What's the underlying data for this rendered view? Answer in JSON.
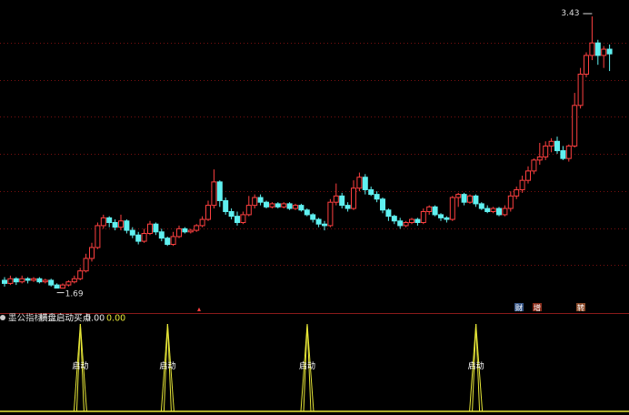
{
  "indicator_bar": {
    "name": "墨公指标",
    "signal_label": "横盘启动买点",
    "value1": "0.00",
    "value2": "0.00"
  },
  "price_annotations": {
    "high_label": "3.43",
    "low_label": "1.69"
  },
  "markers": [
    {
      "text": "财",
      "color": "#3b5a8a"
    },
    {
      "text": "增",
      "color": "#8a2f1e"
    },
    {
      "text": "转",
      "color": "#8a4a2a"
    }
  ],
  "colors": {
    "up": "#ff4040",
    "down": "#5ff0f0",
    "grid": "#7a1010",
    "signal": "#e8e838",
    "separator": "#8a1a1a"
  },
  "chart_data": [
    {
      "type": "candlestick",
      "price_range": [
        1.6,
        3.5
      ],
      "candles": [
        {
          "o": 1.74,
          "c": 1.72,
          "h": 1.76,
          "l": 1.7
        },
        {
          "o": 1.72,
          "c": 1.75,
          "h": 1.77,
          "l": 1.71
        },
        {
          "o": 1.75,
          "c": 1.73,
          "h": 1.76,
          "l": 1.71
        },
        {
          "o": 1.73,
          "c": 1.75,
          "h": 1.77,
          "l": 1.72
        },
        {
          "o": 1.75,
          "c": 1.74,
          "h": 1.76,
          "l": 1.72
        },
        {
          "o": 1.74,
          "c": 1.75,
          "h": 1.76,
          "l": 1.73
        },
        {
          "o": 1.75,
          "c": 1.73,
          "h": 1.76,
          "l": 1.72
        },
        {
          "o": 1.73,
          "c": 1.74,
          "h": 1.75,
          "l": 1.72
        },
        {
          "o": 1.74,
          "c": 1.71,
          "h": 1.75,
          "l": 1.7
        },
        {
          "o": 1.71,
          "c": 1.69,
          "h": 1.72,
          "l": 1.69
        },
        {
          "o": 1.69,
          "c": 1.71,
          "h": 1.72,
          "l": 1.69
        },
        {
          "o": 1.71,
          "c": 1.73,
          "h": 1.74,
          "l": 1.7
        },
        {
          "o": 1.73,
          "c": 1.75,
          "h": 1.77,
          "l": 1.72
        },
        {
          "o": 1.75,
          "c": 1.8,
          "h": 1.82,
          "l": 1.74
        },
        {
          "o": 1.8,
          "c": 1.88,
          "h": 1.91,
          "l": 1.79
        },
        {
          "o": 1.88,
          "c": 1.95,
          "h": 1.98,
          "l": 1.86
        },
        {
          "o": 1.95,
          "c": 2.09,
          "h": 2.11,
          "l": 1.94
        },
        {
          "o": 2.09,
          "c": 2.14,
          "h": 2.16,
          "l": 2.07
        },
        {
          "o": 2.14,
          "c": 2.11,
          "h": 2.15,
          "l": 2.08
        },
        {
          "o": 2.11,
          "c": 2.08,
          "h": 2.13,
          "l": 2.06
        },
        {
          "o": 2.08,
          "c": 2.12,
          "h": 2.16,
          "l": 2.06
        },
        {
          "o": 2.12,
          "c": 2.06,
          "h": 2.13,
          "l": 2.04
        },
        {
          "o": 2.06,
          "c": 2.03,
          "h": 2.08,
          "l": 2.01
        },
        {
          "o": 2.03,
          "c": 1.99,
          "h": 2.05,
          "l": 1.97
        },
        {
          "o": 1.99,
          "c": 2.04,
          "h": 2.07,
          "l": 1.98
        },
        {
          "o": 2.04,
          "c": 2.1,
          "h": 2.12,
          "l": 2.03
        },
        {
          "o": 2.1,
          "c": 2.05,
          "h": 2.11,
          "l": 2.03
        },
        {
          "o": 2.05,
          "c": 2.01,
          "h": 2.07,
          "l": 1.99
        },
        {
          "o": 2.01,
          "c": 1.97,
          "h": 2.02,
          "l": 1.96
        },
        {
          "o": 1.97,
          "c": 2.02,
          "h": 2.05,
          "l": 1.96
        },
        {
          "o": 2.02,
          "c": 2.07,
          "h": 2.09,
          "l": 2.01
        },
        {
          "o": 2.07,
          "c": 2.05,
          "h": 2.08,
          "l": 2.04
        },
        {
          "o": 2.05,
          "c": 2.06,
          "h": 2.07,
          "l": 2.04
        },
        {
          "o": 2.06,
          "c": 2.09,
          "h": 2.1,
          "l": 2.05
        },
        {
          "o": 2.09,
          "c": 2.13,
          "h": 2.15,
          "l": 2.08
        },
        {
          "o": 2.13,
          "c": 2.22,
          "h": 2.25,
          "l": 2.12
        },
        {
          "o": 2.22,
          "c": 2.37,
          "h": 2.45,
          "l": 2.2
        },
        {
          "o": 2.37,
          "c": 2.25,
          "h": 2.38,
          "l": 2.21
        },
        {
          "o": 2.25,
          "c": 2.18,
          "h": 2.27,
          "l": 2.16
        },
        {
          "o": 2.18,
          "c": 2.15,
          "h": 2.2,
          "l": 2.13
        },
        {
          "o": 2.15,
          "c": 2.11,
          "h": 2.18,
          "l": 2.09
        },
        {
          "o": 2.11,
          "c": 2.16,
          "h": 2.18,
          "l": 2.1
        },
        {
          "o": 2.16,
          "c": 2.22,
          "h": 2.28,
          "l": 2.15
        },
        {
          "o": 2.22,
          "c": 2.27,
          "h": 2.29,
          "l": 2.2
        },
        {
          "o": 2.27,
          "c": 2.24,
          "h": 2.29,
          "l": 2.22
        },
        {
          "o": 2.24,
          "c": 2.21,
          "h": 2.25,
          "l": 2.2
        },
        {
          "o": 2.21,
          "c": 2.23,
          "h": 2.24,
          "l": 2.2
        },
        {
          "o": 2.23,
          "c": 2.21,
          "h": 2.24,
          "l": 2.2
        },
        {
          "o": 2.21,
          "c": 2.23,
          "h": 2.24,
          "l": 2.2
        },
        {
          "o": 2.23,
          "c": 2.2,
          "h": 2.24,
          "l": 2.19
        },
        {
          "o": 2.2,
          "c": 2.22,
          "h": 2.23,
          "l": 2.19
        },
        {
          "o": 2.22,
          "c": 2.19,
          "h": 2.23,
          "l": 2.18
        },
        {
          "o": 2.19,
          "c": 2.16,
          "h": 2.2,
          "l": 2.15
        },
        {
          "o": 2.16,
          "c": 2.13,
          "h": 2.17,
          "l": 2.11
        },
        {
          "o": 2.13,
          "c": 2.1,
          "h": 2.14,
          "l": 2.08
        },
        {
          "o": 2.1,
          "c": 2.09,
          "h": 2.12,
          "l": 2.06
        },
        {
          "o": 2.09,
          "c": 2.24,
          "h": 2.26,
          "l": 2.08
        },
        {
          "o": 2.24,
          "c": 2.28,
          "h": 2.36,
          "l": 2.22
        },
        {
          "o": 2.28,
          "c": 2.22,
          "h": 2.3,
          "l": 2.2
        },
        {
          "o": 2.22,
          "c": 2.2,
          "h": 2.24,
          "l": 2.18
        },
        {
          "o": 2.2,
          "c": 2.33,
          "h": 2.38,
          "l": 2.19
        },
        {
          "o": 2.33,
          "c": 2.4,
          "h": 2.43,
          "l": 2.31
        },
        {
          "o": 2.4,
          "c": 2.32,
          "h": 2.42,
          "l": 2.29
        },
        {
          "o": 2.32,
          "c": 2.29,
          "h": 2.34,
          "l": 2.28
        },
        {
          "o": 2.29,
          "c": 2.26,
          "h": 2.31,
          "l": 2.24
        },
        {
          "o": 2.26,
          "c": 2.19,
          "h": 2.27,
          "l": 2.17
        },
        {
          "o": 2.19,
          "c": 2.15,
          "h": 2.2,
          "l": 2.12
        },
        {
          "o": 2.15,
          "c": 2.12,
          "h": 2.16,
          "l": 2.1
        },
        {
          "o": 2.12,
          "c": 2.09,
          "h": 2.14,
          "l": 2.07
        },
        {
          "o": 2.09,
          "c": 2.11,
          "h": 2.12,
          "l": 2.08
        },
        {
          "o": 2.11,
          "c": 2.13,
          "h": 2.14,
          "l": 2.1
        },
        {
          "o": 2.13,
          "c": 2.11,
          "h": 2.14,
          "l": 2.09
        },
        {
          "o": 2.11,
          "c": 2.18,
          "h": 2.2,
          "l": 2.1
        },
        {
          "o": 2.18,
          "c": 2.21,
          "h": 2.22,
          "l": 2.16
        },
        {
          "o": 2.21,
          "c": 2.16,
          "h": 2.22,
          "l": 2.15
        },
        {
          "o": 2.16,
          "c": 2.14,
          "h": 2.17,
          "l": 2.12
        },
        {
          "o": 2.14,
          "c": 2.13,
          "h": 2.15,
          "l": 2.11
        },
        {
          "o": 2.13,
          "c": 2.27,
          "h": 2.28,
          "l": 2.12
        },
        {
          "o": 2.27,
          "c": 2.29,
          "h": 2.3,
          "l": 2.21
        },
        {
          "o": 2.29,
          "c": 2.24,
          "h": 2.3,
          "l": 2.22
        },
        {
          "o": 2.24,
          "c": 2.28,
          "h": 2.29,
          "l": 2.23
        },
        {
          "o": 2.28,
          "c": 2.23,
          "h": 2.29,
          "l": 2.21
        },
        {
          "o": 2.23,
          "c": 2.2,
          "h": 2.24,
          "l": 2.19
        },
        {
          "o": 2.2,
          "c": 2.18,
          "h": 2.22,
          "l": 2.17
        },
        {
          "o": 2.18,
          "c": 2.2,
          "h": 2.21,
          "l": 2.17
        },
        {
          "o": 2.2,
          "c": 2.16,
          "h": 2.21,
          "l": 2.15
        },
        {
          "o": 2.16,
          "c": 2.2,
          "h": 2.22,
          "l": 2.15
        },
        {
          "o": 2.2,
          "c": 2.28,
          "h": 2.31,
          "l": 2.18
        },
        {
          "o": 2.28,
          "c": 2.32,
          "h": 2.34,
          "l": 2.26
        },
        {
          "o": 2.32,
          "c": 2.38,
          "h": 2.41,
          "l": 2.3
        },
        {
          "o": 2.38,
          "c": 2.44,
          "h": 2.47,
          "l": 2.36
        },
        {
          "o": 2.44,
          "c": 2.51,
          "h": 2.52,
          "l": 2.42
        },
        {
          "o": 2.51,
          "c": 2.53,
          "h": 2.62,
          "l": 2.48
        },
        {
          "o": 2.53,
          "c": 2.6,
          "h": 2.63,
          "l": 2.51
        },
        {
          "o": 2.6,
          "c": 2.63,
          "h": 2.65,
          "l": 2.56
        },
        {
          "o": 2.63,
          "c": 2.57,
          "h": 2.66,
          "l": 2.55
        },
        {
          "o": 2.57,
          "c": 2.52,
          "h": 2.6,
          "l": 2.51
        },
        {
          "o": 2.52,
          "c": 2.6,
          "h": 2.61,
          "l": 2.5
        },
        {
          "o": 2.6,
          "c": 2.86,
          "h": 2.94,
          "l": 2.59
        },
        {
          "o": 2.86,
          "c": 3.06,
          "h": 3.1,
          "l": 2.84
        },
        {
          "o": 3.06,
          "c": 3.18,
          "h": 3.2,
          "l": 3.04
        },
        {
          "o": 3.18,
          "c": 3.26,
          "h": 3.43,
          "l": 3.15
        },
        {
          "o": 3.26,
          "c": 3.18,
          "h": 3.28,
          "l": 3.12
        },
        {
          "o": 3.18,
          "c": 3.22,
          "h": 3.24,
          "l": 3.1
        },
        {
          "o": 3.22,
          "c": 3.19,
          "h": 3.25,
          "l": 3.08
        }
      ]
    },
    {
      "type": "line",
      "name": "横盘启动买点",
      "signal_text": "启动",
      "signals_at": [
        11,
        26,
        50,
        79
      ],
      "ylim": [
        0,
        1
      ]
    }
  ]
}
